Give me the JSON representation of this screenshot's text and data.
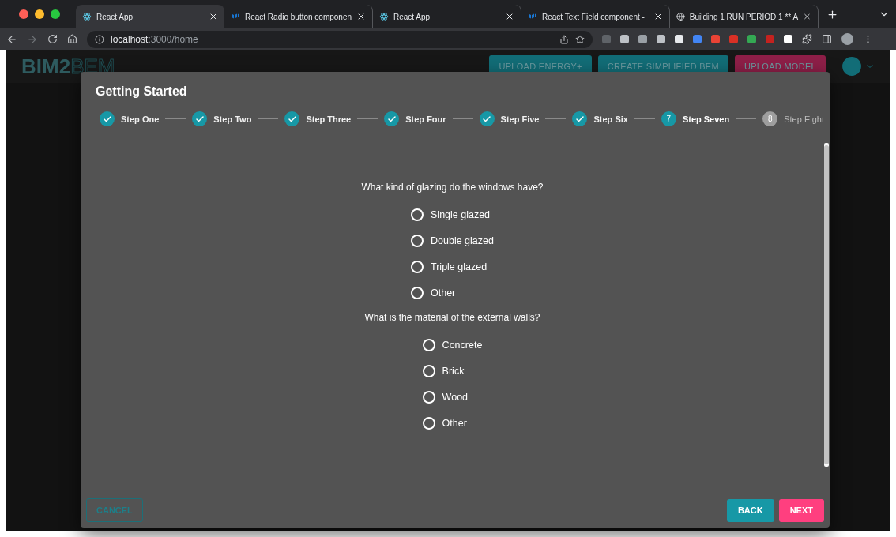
{
  "browser": {
    "tabs": [
      {
        "title": "React App",
        "kind": "react",
        "selected": true
      },
      {
        "title": "React Radio button componen",
        "kind": "mui",
        "selected": false
      },
      {
        "title": "React App",
        "kind": "react",
        "selected": false
      },
      {
        "title": "React Text Field component -",
        "kind": "mui",
        "selected": false
      },
      {
        "title": "Building 1 RUN PERIOD 1 ** A",
        "kind": "globe",
        "selected": false
      }
    ],
    "address": {
      "host": "localhost",
      "path": ":3000/home"
    }
  },
  "app": {
    "logo": {
      "first": "BIM2",
      "second": "BEM"
    },
    "header_buttons": [
      {
        "label": "UPLOAD ENERGY+",
        "color": "#126d77"
      },
      {
        "label": "CREATE SIMPLIFIED BEM",
        "color": "#126d77"
      },
      {
        "label": "UPLOAD MODEL",
        "color": "#8e1f48"
      }
    ]
  },
  "dialog": {
    "title": "Getting Started",
    "steps": [
      {
        "label": "Step One",
        "completed": true,
        "active": false
      },
      {
        "label": "Step Two",
        "completed": true,
        "active": false
      },
      {
        "label": "Step Three",
        "completed": true,
        "active": false
      },
      {
        "label": "Step Four",
        "completed": true,
        "active": false
      },
      {
        "label": "Step Five",
        "completed": true,
        "active": false
      },
      {
        "label": "Step Six",
        "completed": true,
        "active": false
      },
      {
        "label": "Step Seven",
        "completed": false,
        "active": true,
        "number": "7"
      },
      {
        "label": "Step Eight",
        "completed": false,
        "active": false,
        "number": "8"
      }
    ],
    "questions": [
      {
        "prompt": "What kind of glazing do the windows have?",
        "options": [
          {
            "label": "Single glazed",
            "selected": false
          },
          {
            "label": "Double glazed",
            "selected": false
          },
          {
            "label": "Triple glazed",
            "selected": false
          },
          {
            "label": "Other",
            "selected": false
          }
        ]
      },
      {
        "prompt": "What is the material of the external walls?",
        "options": [
          {
            "label": "Concrete",
            "selected": false
          },
          {
            "label": "Brick",
            "selected": false
          },
          {
            "label": "Wood",
            "selected": false
          },
          {
            "label": "Other",
            "selected": false
          }
        ]
      }
    ],
    "actions": {
      "cancel": "CANCEL",
      "back": "BACK",
      "next": "NEXT"
    }
  }
}
